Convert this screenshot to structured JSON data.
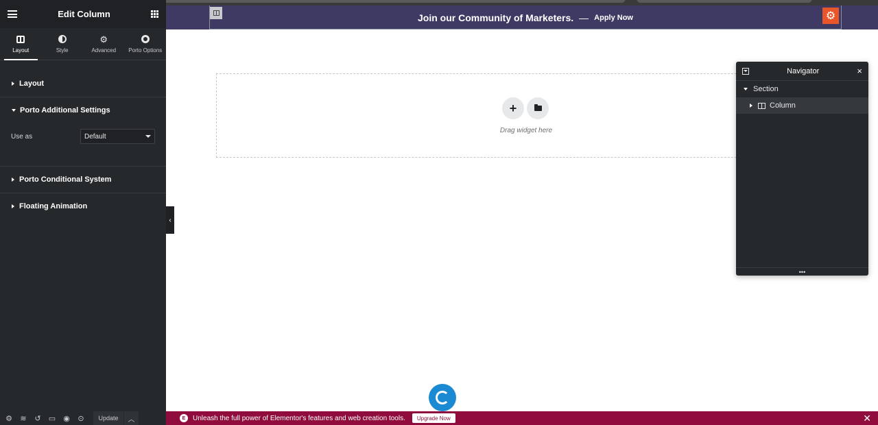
{
  "panel": {
    "title": "Edit Column",
    "tabs": [
      {
        "label": "Layout",
        "icon": "columns-icon",
        "active": true
      },
      {
        "label": "Style",
        "icon": "half-circle-icon"
      },
      {
        "label": "Advanced",
        "icon": "gear-icon"
      },
      {
        "label": "Porto Options",
        "icon": "circle-dot-icon"
      }
    ],
    "sections": {
      "layout": "Layout",
      "porto_additional": "Porto Additional Settings",
      "porto_conditional": "Porto Conditional System",
      "floating_animation": "Floating Animation"
    },
    "use_as": {
      "label": "Use as",
      "value": "Default"
    },
    "footer": {
      "update_label": "Update"
    }
  },
  "banner": {
    "text": "Join our Community of Marketers.",
    "dash": "—",
    "cta": "Apply Now",
    "background": "#3f3a64"
  },
  "dropzone": {
    "text": "Drag widget here",
    "add_symbol": "+"
  },
  "navigator": {
    "title": "Navigator",
    "close_symbol": "×",
    "section_label": "Section",
    "column_label": "Column",
    "resize_symbol": "•••"
  },
  "promo": {
    "logo_letter": "E",
    "text": "Unleash the full power of Elementor's features and web creation tools.",
    "button": "Upgrade Now",
    "close_symbol": "✕",
    "background": "#8f0c3c"
  },
  "colors": {
    "panel_bg": "#26292c",
    "accent_orange": "#e8562a",
    "loader_blue": "#1b8ad3"
  }
}
